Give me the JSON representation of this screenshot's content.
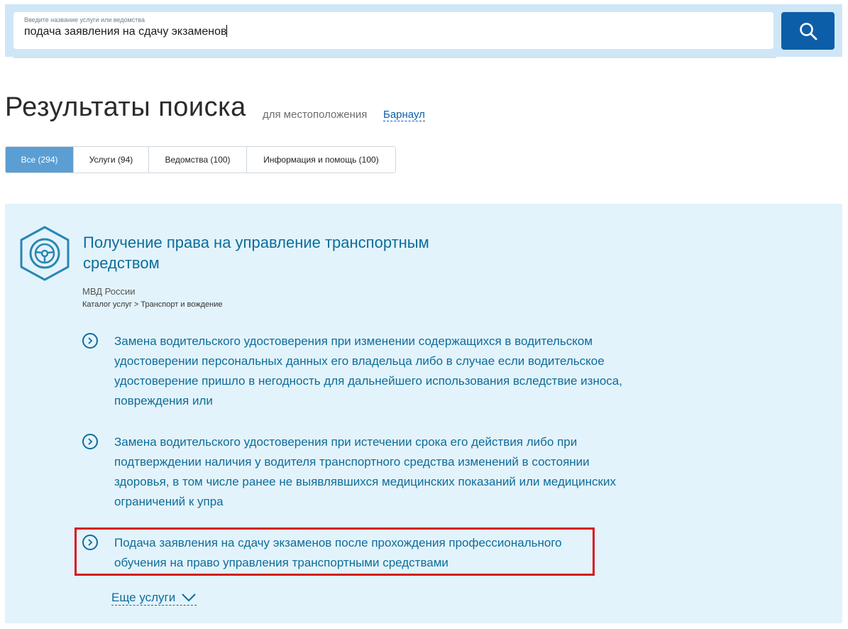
{
  "search": {
    "hint": "Введите название услуги или ведомства",
    "value": "подача заявления на сдачу экзаменов",
    "button_icon": "search-icon"
  },
  "header": {
    "title": "Результаты поиска",
    "location_label": "для местоположения",
    "location_value": "Барнаул"
  },
  "tabs": [
    {
      "label": "Все (294)",
      "active": true
    },
    {
      "label": "Услуги (94)",
      "active": false
    },
    {
      "label": "Ведомства (100)",
      "active": false
    },
    {
      "label": "Информация и помощь (100)",
      "active": false
    }
  ],
  "result": {
    "icon": "steering-wheel-icon",
    "title": "Получение права на управление транспортным средством",
    "department": "МВД России",
    "breadcrumb": "Каталог услуг > Транспорт и вождение",
    "items": [
      "Замена водительского удостоверения при изменении содержащихся в водительском удостоверении персональных данных его владельца либо в случае если водительское удостоверение пришло в негодность для дальнейшего использования вследствие износа, повреждения или",
      "Замена водительского удостоверения при истечении срока его действия либо при подтверждении наличия у водителя транспортного средства изменений в состоянии здоровья, в том числе ранее не выявлявшихся медицинских показаний или медицинских ограничений к упра",
      "Подача заявления на сдачу экзаменов после прохождения профессионального обучения на право управления транспортными средствами"
    ],
    "more_label": "Еще услуги"
  },
  "colors": {
    "accent": "#0d5ea8",
    "link": "#0d6d9b",
    "panel_bg": "#e3f3fb",
    "highlight": "#d7171f",
    "active_tab": "#5b9ed3"
  }
}
